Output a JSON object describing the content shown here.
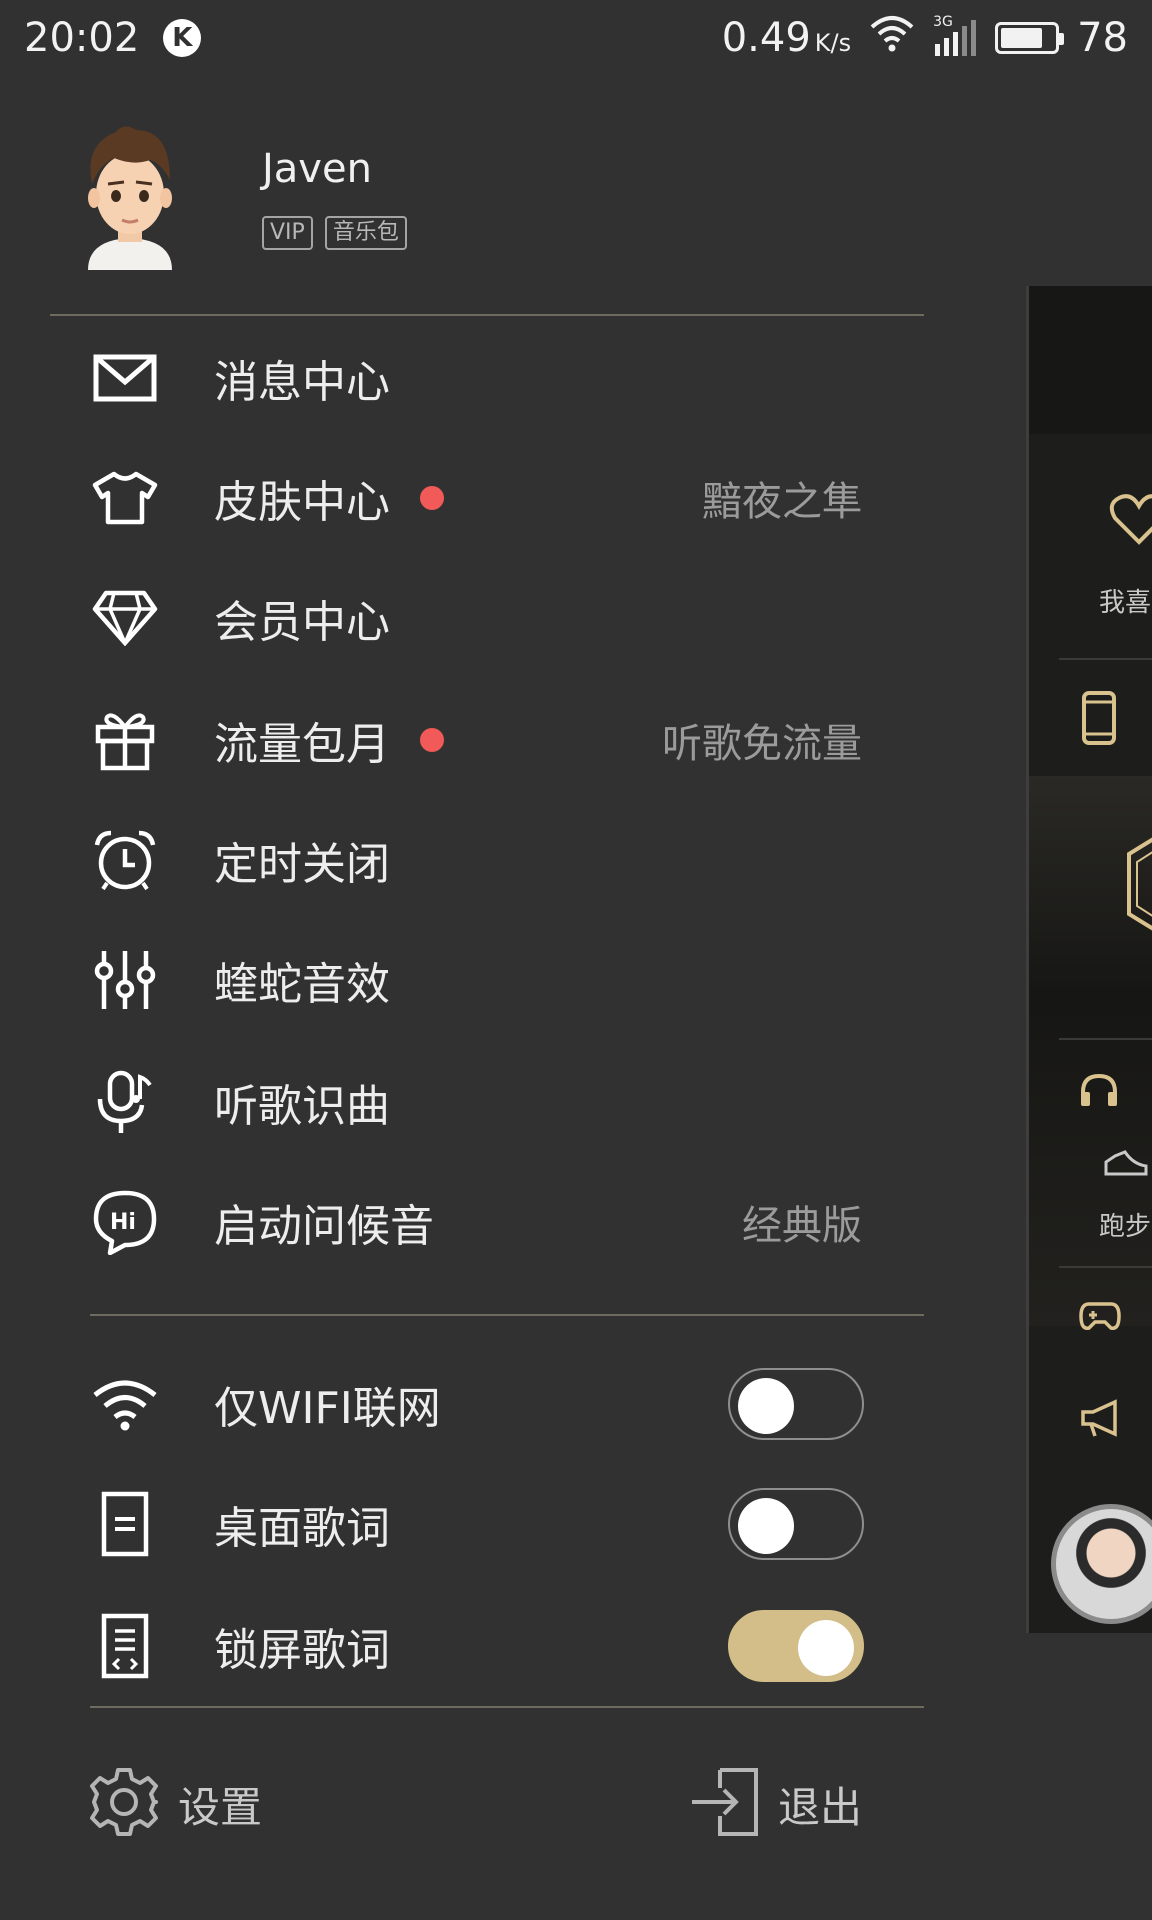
{
  "status_bar": {
    "time": "20:02",
    "app_badge": "K",
    "net_speed": "0.49",
    "net_speed_unit": "K/s",
    "network_type": "3G",
    "battery": "78"
  },
  "profile": {
    "username": "Javen",
    "badges": [
      "VIP",
      "音乐包"
    ]
  },
  "menu": [
    {
      "label": "消息中心",
      "icon": "mail-icon",
      "dot": false,
      "value": ""
    },
    {
      "label": "皮肤中心",
      "icon": "tshirt-icon",
      "dot": true,
      "value": "黯夜之隼"
    },
    {
      "label": "会员中心",
      "icon": "diamond-icon",
      "dot": false,
      "value": ""
    },
    {
      "label": "流量包月",
      "icon": "gift-icon",
      "dot": true,
      "value": "听歌免流量"
    },
    {
      "label": "定时关闭",
      "icon": "alarm-clock-icon",
      "dot": false,
      "value": ""
    },
    {
      "label": "蝰蛇音效",
      "icon": "equalizer-icon",
      "dot": false,
      "value": ""
    },
    {
      "label": "听歌识曲",
      "icon": "mic-note-icon",
      "dot": false,
      "value": ""
    },
    {
      "label": "启动问候音",
      "icon": "hi-bubble-icon",
      "dot": false,
      "value": "经典版"
    }
  ],
  "toggles": [
    {
      "label": "仅WIFI联网",
      "icon": "wifi-icon",
      "on": false
    },
    {
      "label": "桌面歌词",
      "icon": "desktop-lyrics-icon",
      "on": false
    },
    {
      "label": "锁屏歌词",
      "icon": "lockscreen-lyrics-icon",
      "on": true
    }
  ],
  "footer": {
    "settings_label": "设置",
    "logout_label": "退出"
  },
  "peek_panel": {
    "favorites_label": "我喜",
    "running_label": "跑步"
  },
  "colors": {
    "background": "#313131",
    "accent_gold": "#d3be89",
    "red_dot": "#f25a5a",
    "divider": "#6f6a5f"
  }
}
